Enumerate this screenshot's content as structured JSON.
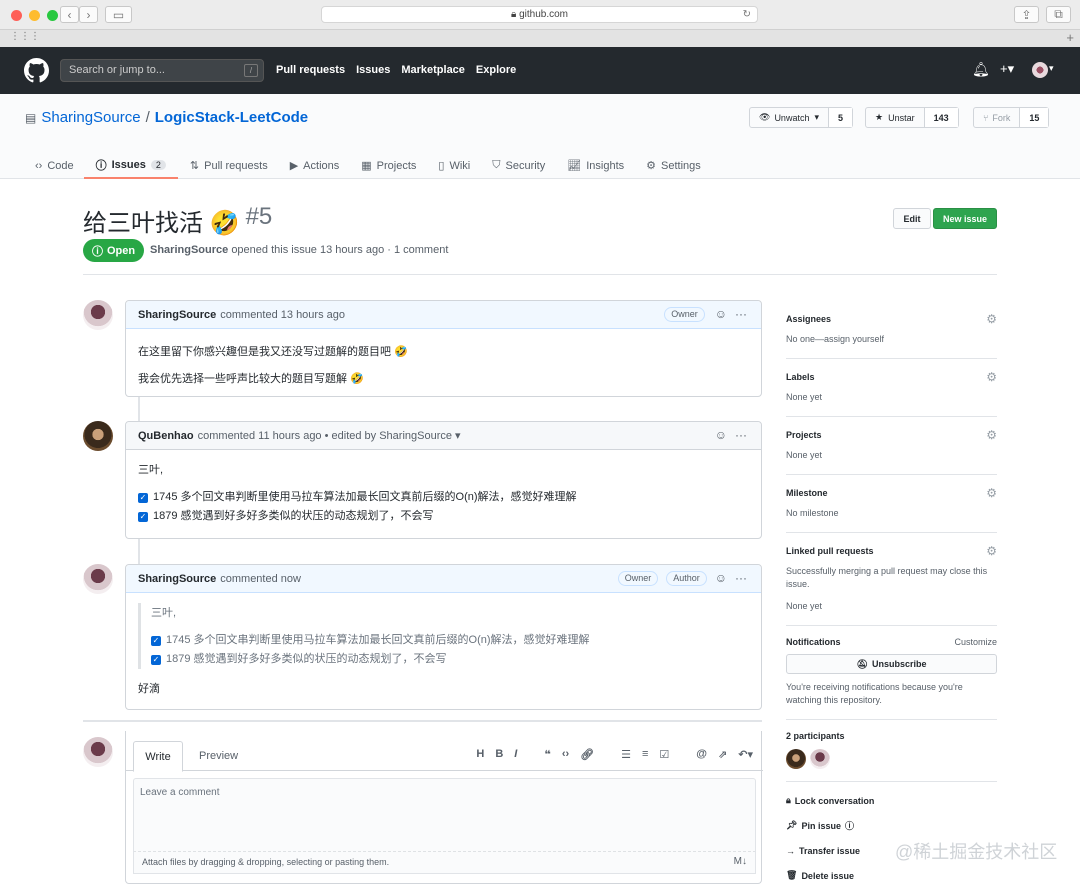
{
  "browser": {
    "url": "github.com"
  },
  "header": {
    "search_placeholder": "Search or jump to...",
    "slash": "/",
    "nav": [
      "Pull requests",
      "Issues",
      "Marketplace",
      "Explore"
    ]
  },
  "repo": {
    "owner": "SharingSource",
    "sep": "/",
    "name": "LogicStack-LeetCode",
    "watch": {
      "label": "Unwatch",
      "count": "5"
    },
    "star": {
      "label": "Unstar",
      "count": "143"
    },
    "fork": {
      "label": "Fork",
      "count": "15"
    },
    "tabs": [
      {
        "label": "Code"
      },
      {
        "label": "Issues",
        "count": "2"
      },
      {
        "label": "Pull requests"
      },
      {
        "label": "Actions"
      },
      {
        "label": "Projects"
      },
      {
        "label": "Wiki"
      },
      {
        "label": "Security"
      },
      {
        "label": "Insights"
      },
      {
        "label": "Settings"
      }
    ]
  },
  "issue": {
    "title": "给三叶找活 🤣",
    "number": "#5",
    "state": "Open",
    "author": "SharingSource",
    "meta": "opened this issue 13 hours ago · 1 comment",
    "edit_label": "Edit",
    "new_label": "New issue"
  },
  "comments": [
    {
      "author": "SharingSource",
      "meta": "commented 13 hours ago",
      "labels": [
        "Owner"
      ],
      "lines": [
        "在这里留下你感兴趣但是我又还没写过题解的题目吧 🤣",
        "我会优先选择一些呼声比较大的题目写题解 🤣"
      ]
    },
    {
      "author": "QuBenhao",
      "meta": "commented 11 hours ago • edited by SharingSource ▾",
      "labels": [],
      "intro": "三叶,",
      "tasks": [
        "1745 多个回文串判断里使用马拉车算法加最长回文真前后缀的O(n)解法，感觉好难理解",
        "1879 感觉遇到好多好多类似的状压的动态规划了，不会写"
      ]
    },
    {
      "author": "SharingSource",
      "meta": "commented now",
      "labels": [
        "Owner",
        "Author"
      ],
      "quote_intro": "三叶,",
      "quote_tasks": [
        "1745 多个回文串判断里使用马拉车算法加最长回文真前后缀的O(n)解法，感觉好难理解",
        "1879 感觉遇到好多好多类似的状压的动态规划了，不会写"
      ],
      "reply": "好滴"
    }
  ],
  "editor": {
    "write": "Write",
    "preview": "Preview",
    "placeholder": "Leave a comment",
    "attach": "Attach files by dragging & dropping, selecting or pasting them."
  },
  "sidebar": {
    "assignees": {
      "title": "Assignees",
      "value": "No one—assign yourself"
    },
    "labels": {
      "title": "Labels",
      "value": "None yet"
    },
    "projects": {
      "title": "Projects",
      "value": "None yet"
    },
    "milestone": {
      "title": "Milestone",
      "value": "No milestone"
    },
    "linked": {
      "title": "Linked pull requests",
      "desc": "Successfully merging a pull request may close this issue.",
      "value": "None yet"
    },
    "notifications": {
      "title": "Notifications",
      "customize": "Customize",
      "button": "Unsubscribe",
      "desc": "You're receiving notifications because you're watching this repository."
    },
    "participants": {
      "title": "2 participants"
    },
    "actions": [
      "Lock conversation",
      "Pin issue",
      "Transfer issue",
      "Delete issue"
    ]
  },
  "watermark": "@稀土掘金技术社区"
}
